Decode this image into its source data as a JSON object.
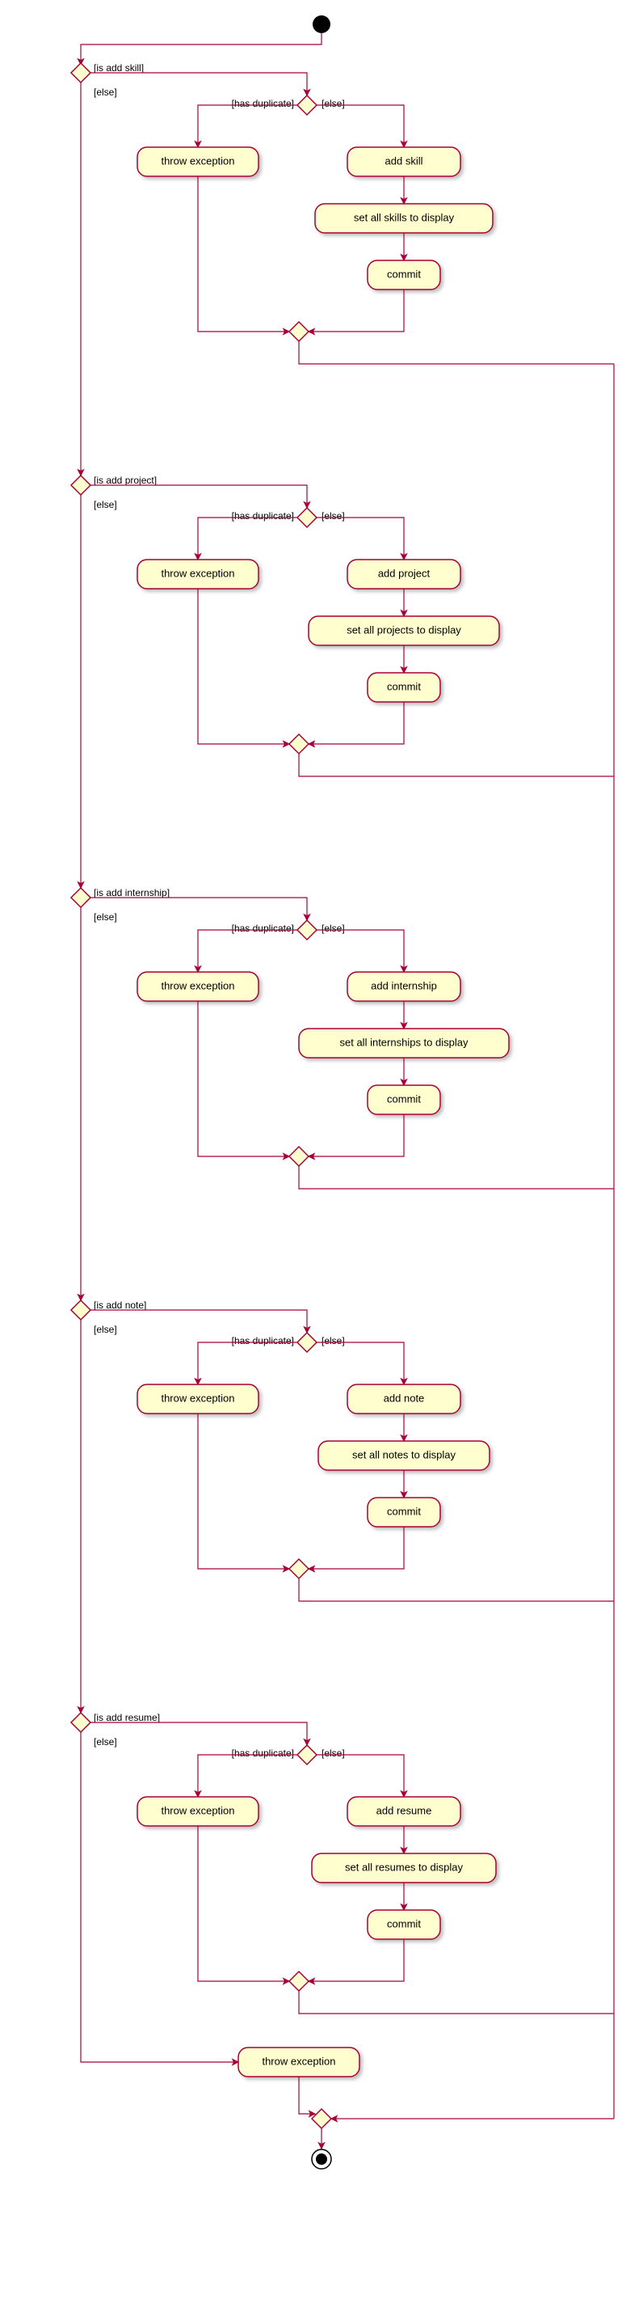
{
  "blocks": [
    {
      "condition": "[is add skill]",
      "else": "[else]",
      "dup_condition": "[has duplicate]",
      "dup_else": "[else]",
      "throw": "throw exception",
      "add": "add skill",
      "set": "set all skills to display",
      "commit": "commit"
    },
    {
      "condition": "[is add project]",
      "else": "[else]",
      "dup_condition": "[has duplicate]",
      "dup_else": "[else]",
      "throw": "throw exception",
      "add": "add project",
      "set": "set all projects to display",
      "commit": "commit"
    },
    {
      "condition": "[is add internship]",
      "else": "[else]",
      "dup_condition": "[has duplicate]",
      "dup_else": "[else]",
      "throw": "throw exception",
      "add": "add internship",
      "set": "set all internships to display",
      "commit": "commit"
    },
    {
      "condition": "[is add note]",
      "else": "[else]",
      "dup_condition": "[has duplicate]",
      "dup_else": "[else]",
      "throw": "throw exception",
      "add": "add note",
      "set": "set all notes to display",
      "commit": "commit"
    },
    {
      "condition": "[is add resume]",
      "else": "[else]",
      "dup_condition": "[has duplicate]",
      "dup_else": "[else]",
      "throw": "throw exception",
      "add": "add resume",
      "set": "set all resumes to display",
      "commit": "commit"
    }
  ],
  "final_throw": "throw exception",
  "chart_data": {
    "type": "activity-diagram",
    "start": "initial-node",
    "flow": "Cascading conditional: check is add skill → is add project → is add internship → is add note → is add resume, each with duplicate-check sub-branch, else falls through to final throw exception, all paths merge to final node",
    "branches": [
      {
        "guard": "is add skill",
        "duplicate_branch": {
          "has_duplicate": "throw exception",
          "else": [
            "add skill",
            "set all skills to display",
            "commit"
          ]
        }
      },
      {
        "guard": "is add project",
        "duplicate_branch": {
          "has_duplicate": "throw exception",
          "else": [
            "add project",
            "set all projects to display",
            "commit"
          ]
        }
      },
      {
        "guard": "is add internship",
        "duplicate_branch": {
          "has_duplicate": "throw exception",
          "else": [
            "add internship",
            "set all internships to display",
            "commit"
          ]
        }
      },
      {
        "guard": "is add note",
        "duplicate_branch": {
          "has_duplicate": "throw exception",
          "else": [
            "add note",
            "set all notes to display",
            "commit"
          ]
        }
      },
      {
        "guard": "is add resume",
        "duplicate_branch": {
          "has_duplicate": "throw exception",
          "else": [
            "add resume",
            "set all resumes to display",
            "commit"
          ]
        }
      }
    ],
    "else_path": "throw exception",
    "end": "final-node"
  }
}
